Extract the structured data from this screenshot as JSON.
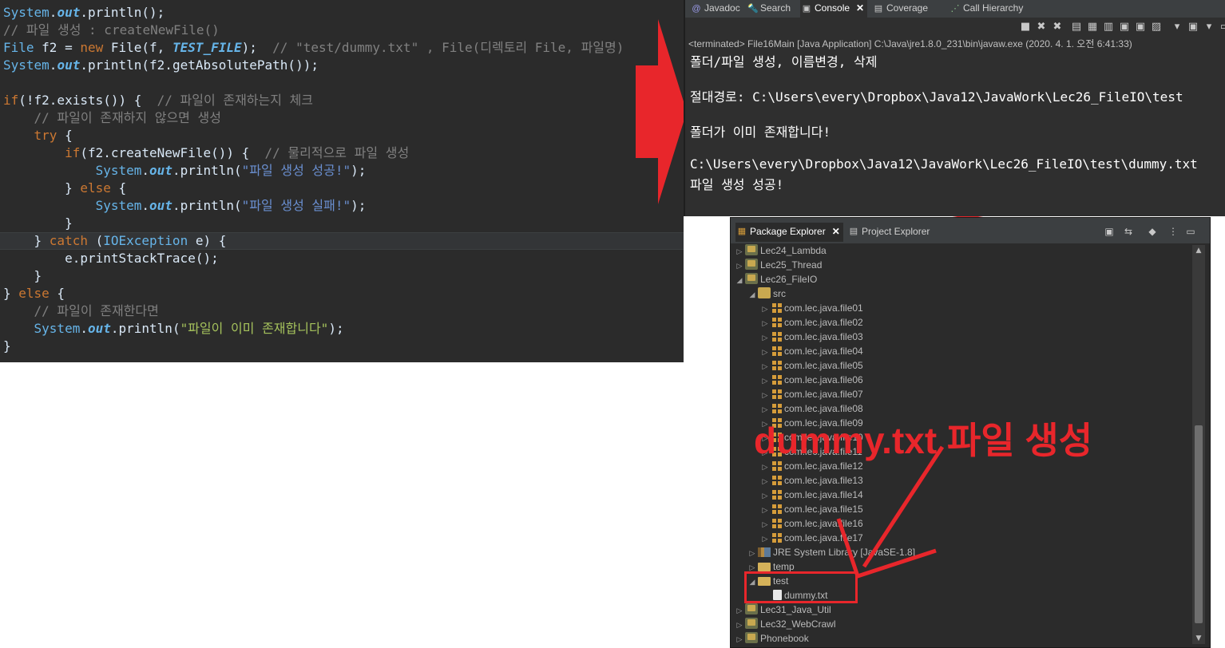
{
  "editor": {
    "lines": [
      [
        {
          "c": "cls",
          "t": "System"
        },
        {
          "c": "var",
          "t": "."
        },
        {
          "c": "fld",
          "t": "out"
        },
        {
          "c": "var",
          "t": ".println();"
        }
      ],
      [
        {
          "c": "com",
          "t": "// 파일 생성 : createNewFile()"
        }
      ],
      [
        {
          "c": "cls",
          "t": "File"
        },
        {
          "c": "var",
          "t": " f2 = "
        },
        {
          "c": "kw",
          "t": "new"
        },
        {
          "c": "var",
          "t": " File(f, "
        },
        {
          "c": "fld",
          "t": "TEST_FILE"
        },
        {
          "c": "var",
          "t": ");  "
        },
        {
          "c": "com",
          "t": "// \"test/dummy.txt\" , File(디렉토리 File, 파일명)"
        }
      ],
      [
        {
          "c": "cls",
          "t": "System"
        },
        {
          "c": "var",
          "t": "."
        },
        {
          "c": "fld",
          "t": "out"
        },
        {
          "c": "var",
          "t": ".println(f2.getAbsolutePath());"
        }
      ],
      [],
      [
        {
          "c": "kw",
          "t": "if"
        },
        {
          "c": "var",
          "t": "(!f2.exists()) {  "
        },
        {
          "c": "com",
          "t": "// 파일이 존재하는지 체크"
        }
      ],
      [
        {
          "c": "var",
          "t": "    "
        },
        {
          "c": "com",
          "t": "// 파일이 존재하지 않으면 생성"
        }
      ],
      [
        {
          "c": "var",
          "t": "    "
        },
        {
          "c": "kw",
          "t": "try"
        },
        {
          "c": "var",
          "t": " {"
        }
      ],
      [
        {
          "c": "var",
          "t": "        "
        },
        {
          "c": "kw",
          "t": "if"
        },
        {
          "c": "var",
          "t": "(f2.createNewFile()) {  "
        },
        {
          "c": "com",
          "t": "// 물리적으로 파일 생성"
        }
      ],
      [
        {
          "c": "var",
          "t": "            "
        },
        {
          "c": "cls",
          "t": "System"
        },
        {
          "c": "var",
          "t": "."
        },
        {
          "c": "fld",
          "t": "out"
        },
        {
          "c": "var",
          "t": ".println("
        },
        {
          "c": "str",
          "t": "\"파일 생성 성공!\""
        },
        {
          "c": "var",
          "t": ");"
        }
      ],
      [
        {
          "c": "var",
          "t": "        } "
        },
        {
          "c": "kw",
          "t": "else"
        },
        {
          "c": "var",
          "t": " {"
        }
      ],
      [
        {
          "c": "var",
          "t": "            "
        },
        {
          "c": "cls",
          "t": "System"
        },
        {
          "c": "var",
          "t": "."
        },
        {
          "c": "fld",
          "t": "out"
        },
        {
          "c": "var",
          "t": ".println("
        },
        {
          "c": "str",
          "t": "\"파일 생성 실패!\""
        },
        {
          "c": "var",
          "t": ");"
        }
      ],
      [
        {
          "c": "var",
          "t": "        }"
        }
      ],
      [
        {
          "c": "var",
          "t": "    } "
        },
        {
          "c": "kw",
          "t": "catch"
        },
        {
          "c": "var",
          "t": " ("
        },
        {
          "c": "cls",
          "t": "IOException"
        },
        {
          "c": "var",
          "t": " e) {"
        }
      ],
      [
        {
          "c": "var",
          "t": "        e.printStackTrace();"
        }
      ],
      [
        {
          "c": "var",
          "t": "    }"
        }
      ],
      [
        {
          "c": "var",
          "t": "} "
        },
        {
          "c": "kw",
          "t": "else"
        },
        {
          "c": "var",
          "t": " {"
        }
      ],
      [
        {
          "c": "var",
          "t": "    "
        },
        {
          "c": "com",
          "t": "// 파일이 존재한다면"
        }
      ],
      [
        {
          "c": "var",
          "t": "    "
        },
        {
          "c": "cls",
          "t": "System"
        },
        {
          "c": "var",
          "t": "."
        },
        {
          "c": "fld",
          "t": "out"
        },
        {
          "c": "var",
          "t": ".println("
        },
        {
          "c": "str2",
          "t": "\"파일이 이미 존재합니다\""
        },
        {
          "c": "var",
          "t": ");"
        }
      ],
      [
        {
          "c": "var",
          "t": "}"
        }
      ]
    ]
  },
  "console": {
    "tabs": [
      {
        "label": "Javadoc",
        "icon": "javadoc-icon",
        "glyph": "@",
        "color": "#9a9ae8",
        "active": false
      },
      {
        "label": "Search",
        "icon": "search-icon",
        "glyph": "🔦",
        "color": "#e0c070",
        "active": false
      },
      {
        "label": "Console",
        "icon": "console-icon",
        "glyph": "▣",
        "color": "#c8c8c8",
        "active": true
      },
      {
        "label": "Coverage",
        "icon": "coverage-icon",
        "glyph": "▤",
        "color": "#c8c8c8",
        "active": false
      },
      {
        "label": "Call Hierarchy",
        "icon": "call-hierarchy-icon",
        "glyph": "⋰",
        "color": "#8ac08a",
        "active": false
      }
    ],
    "close_glyph": "✕",
    "status": "<terminated> File16Main [Java Application] C:\\Java\\jre1.8.0_231\\bin\\javaw.exe (2020. 4. 1. 오전 6:41:33)",
    "output": [
      "폴더/파일 생성, 이름변경, 삭제",
      "",
      "절대경로: C:\\Users\\every\\Dropbox\\Java12\\JavaWork\\Lec26_FileIO\\test",
      "",
      "폴더가 이미 존재합니다!",
      "",
      "C:\\Users\\every\\Dropbox\\Java12\\JavaWork\\Lec26_FileIO\\test\\dummy.txt",
      "파일 생성 성공!"
    ],
    "toolbar_icons": [
      {
        "name": "terminate-icon",
        "glyph": "■"
      },
      {
        "name": "remove-launch-icon",
        "glyph": "✖"
      },
      {
        "name": "remove-all-icon",
        "glyph": "✖"
      },
      {
        "name": "clear-console-icon",
        "glyph": "▤"
      },
      {
        "name": "scroll-lock-icon",
        "glyph": "▦"
      },
      {
        "name": "word-wrap-icon",
        "glyph": "▥"
      },
      {
        "name": "show-on-output-icon",
        "glyph": "▣"
      },
      {
        "name": "show-on-error-icon",
        "glyph": "▣"
      },
      {
        "name": "pin-console-icon",
        "glyph": "▨"
      },
      {
        "name": "display-console-icon",
        "glyph": "▾"
      },
      {
        "name": "open-console-icon",
        "glyph": "▣"
      },
      {
        "name": "view-menu-icon",
        "glyph": "▾"
      },
      {
        "name": "minimize-icon",
        "glyph": "▭"
      }
    ]
  },
  "explorer": {
    "tabs": [
      {
        "label": "Package Explorer",
        "icon": "package-explorer-icon",
        "active": true
      },
      {
        "label": "Project Explorer",
        "icon": "project-explorer-icon",
        "active": false
      }
    ],
    "close_glyph": "✕",
    "toolbar_icons": [
      {
        "name": "collapse-all-icon",
        "glyph": "▣"
      },
      {
        "name": "link-with-editor-icon",
        "glyph": "⇆"
      },
      {
        "name": "focus-icon",
        "glyph": "◆"
      },
      {
        "name": "view-menu-icon",
        "glyph": "⋮"
      },
      {
        "name": "minimize-icon",
        "glyph": "▭"
      }
    ],
    "tree": [
      {
        "label": "Lec24_Lambda",
        "level": 0,
        "exp": "▷",
        "icon": "project"
      },
      {
        "label": "Lec25_Thread",
        "level": 0,
        "exp": "▷",
        "icon": "project"
      },
      {
        "label": "Lec26_FileIO",
        "level": 0,
        "exp": "◢",
        "icon": "project"
      },
      {
        "label": "src",
        "level": 1,
        "exp": "◢",
        "icon": "src"
      },
      {
        "label": "com.lec.java.file01",
        "level": 2,
        "exp": "▷",
        "icon": "pkg"
      },
      {
        "label": "com.lec.java.file02",
        "level": 2,
        "exp": "▷",
        "icon": "pkg"
      },
      {
        "label": "com.lec.java.file03",
        "level": 2,
        "exp": "▷",
        "icon": "pkg"
      },
      {
        "label": "com.lec.java.file04",
        "level": 2,
        "exp": "▷",
        "icon": "pkg"
      },
      {
        "label": "com.lec.java.file05",
        "level": 2,
        "exp": "▷",
        "icon": "pkg"
      },
      {
        "label": "com.lec.java.file06",
        "level": 2,
        "exp": "▷",
        "icon": "pkg"
      },
      {
        "label": "com.lec.java.file07",
        "level": 2,
        "exp": "▷",
        "icon": "pkg"
      },
      {
        "label": "com.lec.java.file08",
        "level": 2,
        "exp": "▷",
        "icon": "pkg"
      },
      {
        "label": "com.lec.java.file09",
        "level": 2,
        "exp": "▷",
        "icon": "pkg"
      },
      {
        "label": "com.lec.java.file10",
        "level": 2,
        "exp": "▷",
        "icon": "pkg"
      },
      {
        "label": "com.lec.java.file11",
        "level": 2,
        "exp": "▷",
        "icon": "pkg"
      },
      {
        "label": "com.lec.java.file12",
        "level": 2,
        "exp": "▷",
        "icon": "pkg"
      },
      {
        "label": "com.lec.java.file13",
        "level": 2,
        "exp": "▷",
        "icon": "pkg"
      },
      {
        "label": "com.lec.java.file14",
        "level": 2,
        "exp": "▷",
        "icon": "pkg"
      },
      {
        "label": "com.lec.java.file15",
        "level": 2,
        "exp": "▷",
        "icon": "pkg"
      },
      {
        "label": "com.lec.java.file16",
        "level": 2,
        "exp": "▷",
        "icon": "pkg"
      },
      {
        "label": "com.lec.java.file17",
        "level": 2,
        "exp": "▷",
        "icon": "pkg"
      },
      {
        "label": "JRE System Library [JavaSE-1.8]",
        "level": 1,
        "exp": "▷",
        "icon": "lib"
      },
      {
        "label": "temp",
        "level": 1,
        "exp": "▷",
        "icon": "folder"
      },
      {
        "label": "test",
        "level": 1,
        "exp": "◢",
        "icon": "folder"
      },
      {
        "label": "dummy.txt",
        "level": 2,
        "exp": "",
        "icon": "file"
      },
      {
        "label": "Lec31_Java_Util",
        "level": 0,
        "exp": "▷",
        "icon": "project"
      },
      {
        "label": "Lec32_WebCrawl",
        "level": 0,
        "exp": "▷",
        "icon": "project"
      },
      {
        "label": "Phonebook",
        "level": 0,
        "exp": "▷",
        "icon": "project"
      }
    ]
  },
  "annotation": {
    "text": "dummy.txt 파일 생성",
    "color": "#e8262b"
  }
}
